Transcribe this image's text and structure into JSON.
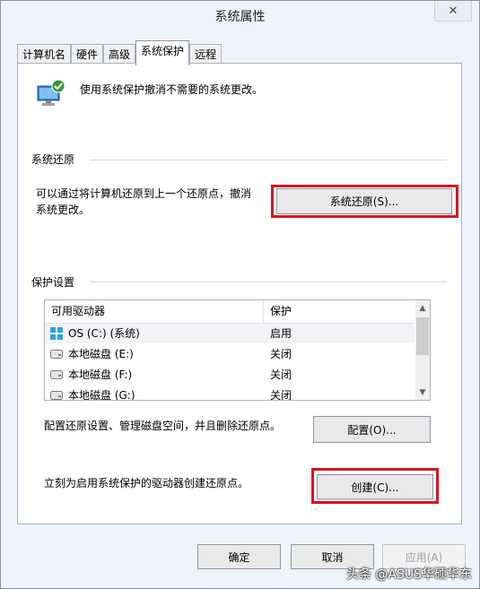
{
  "window": {
    "title": "系统属性",
    "close_glyph": "✕"
  },
  "tabs": [
    {
      "label": "计算机名"
    },
    {
      "label": "硬件"
    },
    {
      "label": "高级"
    },
    {
      "label": "系统保护",
      "active": true
    },
    {
      "label": "远程"
    }
  ],
  "intro": {
    "description": "使用系统保护撤消不需要的系统更改。",
    "icon": "computer-shield-icon"
  },
  "restore": {
    "group_label": "系统还原",
    "text_line1": "可以通过将计算机还原到上一个还原点，撤消",
    "text_line2": "系统更改。",
    "button_label": "系统还原(S)..."
  },
  "protection": {
    "group_label": "保护设置",
    "columns": [
      "可用驱动器",
      "保护"
    ],
    "drives": [
      {
        "name": "OS (C:) (系统)",
        "status": "启用",
        "icon": "system-drive-icon",
        "selected": true
      },
      {
        "name": "本地磁盘 (E:)",
        "status": "关闭",
        "icon": "disk-drive-icon"
      },
      {
        "name": "本地磁盘 (F:)",
        "status": "关闭",
        "icon": "disk-drive-icon"
      },
      {
        "name": "本地磁盘 (G:)",
        "status": "关闭",
        "icon": "disk-drive-icon"
      }
    ],
    "configure_text": "配置还原设置、管理磁盘空间，并且删除还原点。",
    "configure_button": "配置(O)...",
    "create_text": "立刻为启用系统保护的驱动器创建还原点。",
    "create_button": "创建(C)..."
  },
  "footer": {
    "ok": "确定",
    "cancel": "取消",
    "apply": "应用(A)"
  },
  "watermark": "头条 @ASUS华硕华东",
  "colors": {
    "highlight": "#d9141e",
    "window_bg": "#eff4fb",
    "panel_bg": "#ffffff"
  }
}
